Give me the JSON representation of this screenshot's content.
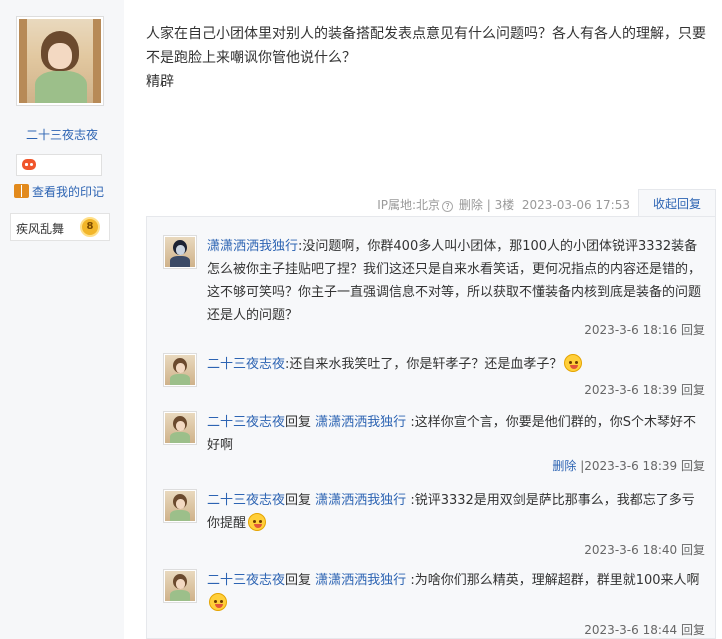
{
  "user": {
    "name": "二十三夜志夜",
    "mark_link": "查看我的印记",
    "level_name": "疾风乱舞",
    "level_num": "8"
  },
  "post": {
    "lines": [
      "人家在自己小团体里对别人的装备搭配发表点意见有什么问题吗？各人有各人的理解，只要",
      "不是跑脸上来嘲讽你管他说什么？",
      "精辟"
    ],
    "ip": "IP属地:北京",
    "delete": "删除",
    "sep": "|",
    "floor": "3楼",
    "time": "2023-03-06 17:53",
    "collapse": "收起回复"
  },
  "replies": [
    {
      "name": "潇潇洒洒我独行",
      "reply_to": "",
      "text": ":没问题啊，你群400多人叫小团体，那100人的小团体锐评3332装备怎么被你主子挂贴吧了捏？我们这还只是自来水看笑话，更何况指点的内容还是错的，这不够可笑吗？你主子一直强调信息不对等，所以获取不懂装备内核到底是装备的问题还是人的问题？",
      "delete": "",
      "time": "2023-3-6 18:16",
      "reply_btn": "回复"
    },
    {
      "name": "二十三夜志夜",
      "reply_to": "",
      "text": ":还自来水我笑吐了，你是轩孝子？还是血孝子？",
      "delete": "",
      "time": "2023-3-6 18:39",
      "reply_btn": "回复"
    },
    {
      "name": "二十三夜志夜",
      "reply_word": "回复",
      "reply_to": "潇潇洒洒我独行",
      "text": ":这样你宣个言，你要是他们群的，你S个木琴好不好啊",
      "delete": "删除",
      "time": "|2023-3-6 18:39",
      "reply_btn": "回复"
    },
    {
      "name": "二十三夜志夜",
      "reply_word": "回复",
      "reply_to": "潇潇洒洒我独行",
      "text": ":锐评3332是用双剑是萨比那事么，我都忘了多亏你提醒",
      "delete": "",
      "time": "2023-3-6 18:40",
      "reply_btn": "回复"
    },
    {
      "name": "二十三夜志夜",
      "reply_word": "回复",
      "reply_to": "潇潇洒洒我独行",
      "text": ":为啥你们那么精英，理解超群，群里就100来人啊",
      "delete": "",
      "time": "2023-3-6 18:44",
      "reply_btn": "回复"
    }
  ]
}
